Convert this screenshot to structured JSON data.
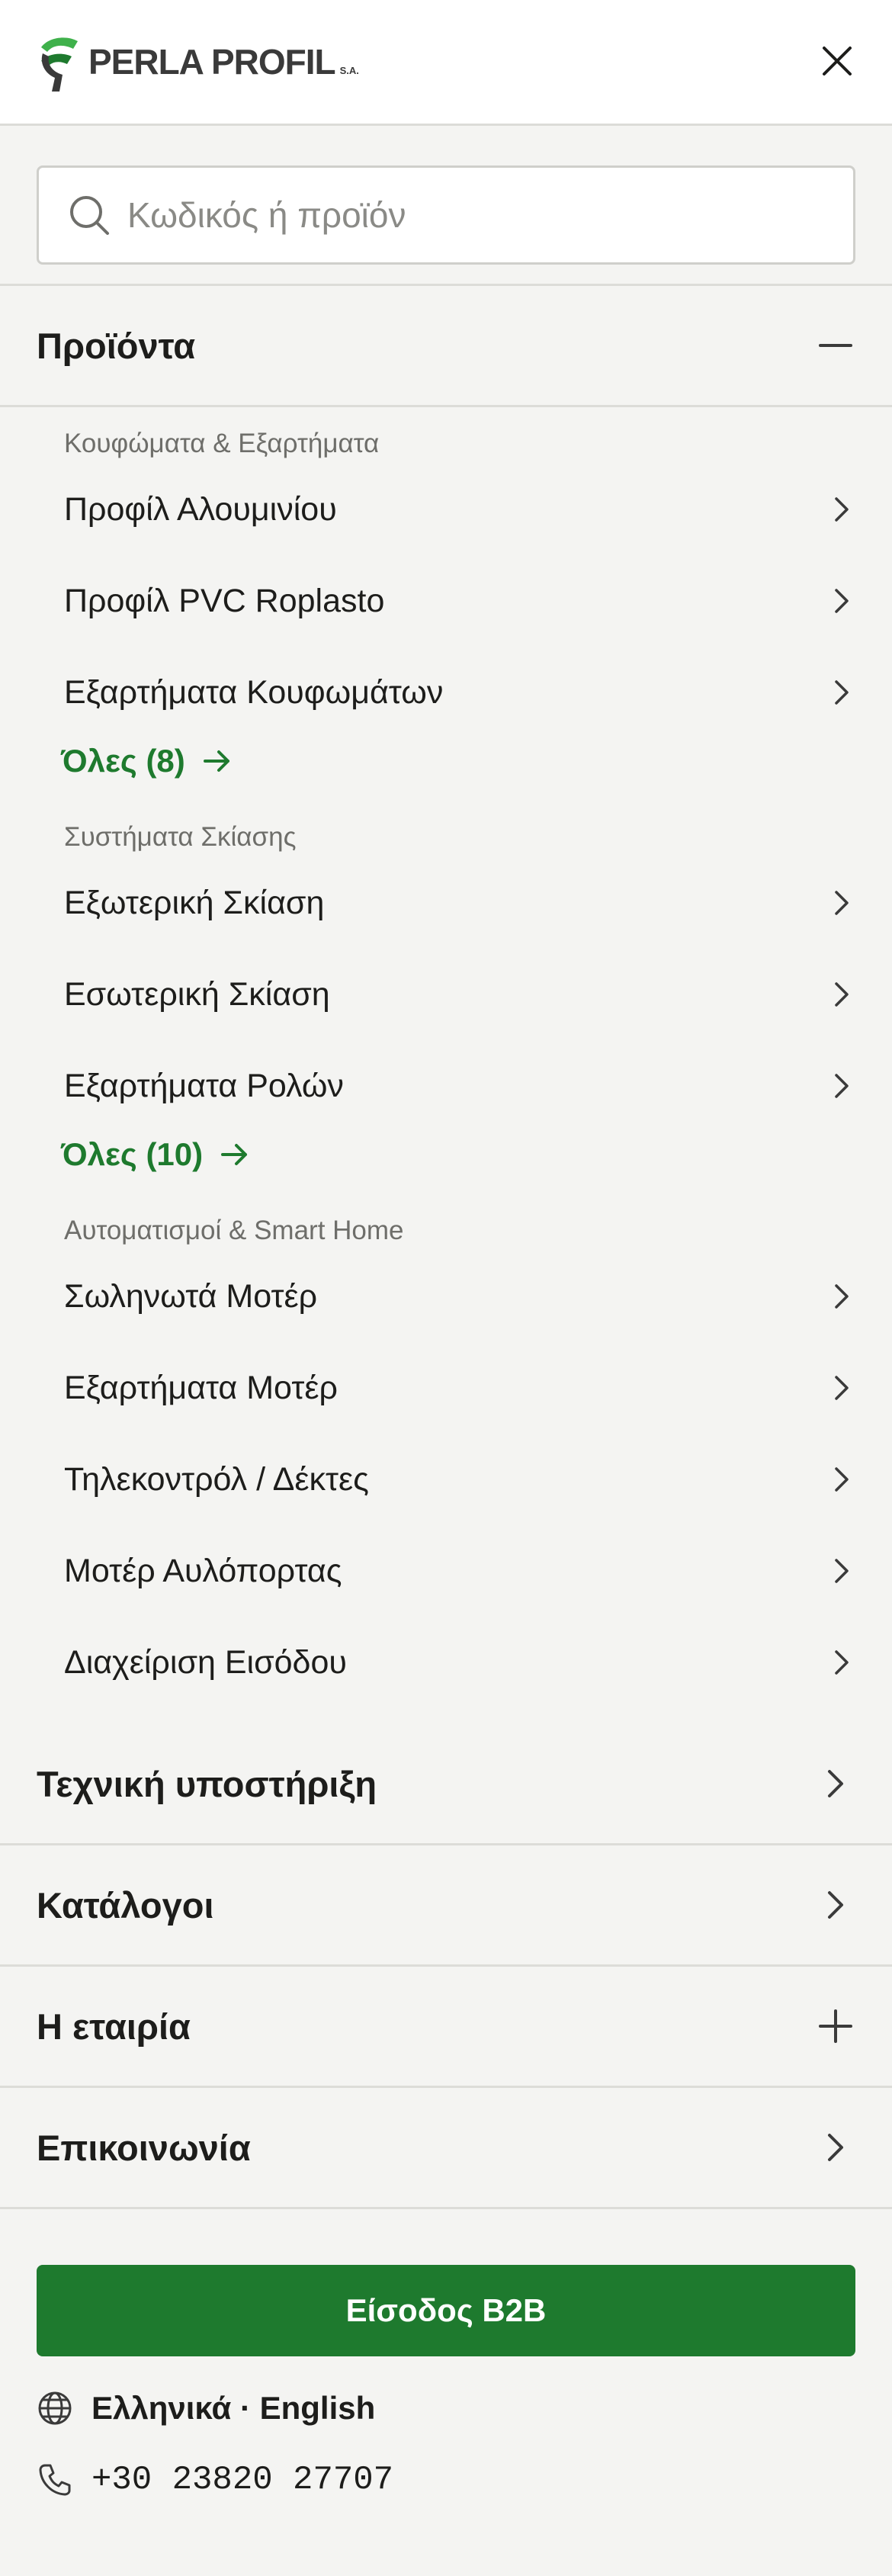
{
  "brand": {
    "name": "PERLA PROFIL",
    "suffix": "S.A.",
    "accent": "#1e7a2e",
    "logo_colors": [
      "#3fb14b",
      "#1e7a2e",
      "#3a3a3a"
    ]
  },
  "header": {
    "close_icon": "close-icon"
  },
  "search": {
    "placeholder": "Κωδικός ή προϊόν",
    "value": "",
    "icon": "search-icon"
  },
  "menu": {
    "products": {
      "label": "Προϊόντα",
      "expanded": true,
      "toggle_icon": "minus-icon",
      "groups": [
        {
          "title": "Κουφώματα & Εξαρτήματα",
          "items": [
            "Προφίλ Αλουμινίου",
            "Προφίλ PVC Roplasto",
            "Εξαρτήματα Κουφωμάτων"
          ],
          "all_label": "Όλες (8)"
        },
        {
          "title": "Συστήματα Σκίασης",
          "items": [
            "Εξωτερική Σκίαση",
            "Εσωτερική Σκίαση",
            "Εξαρτήματα Ρολών"
          ],
          "all_label": "Όλες (10)"
        },
        {
          "title": "Αυτοματισμοί & Smart Home",
          "items": [
            "Σωληνωτά Μοτέρ",
            "Εξαρτήματα Μοτέρ",
            "Τηλεκοντρόλ / Δέκτες",
            "Μοτέρ Αυλόπορτας",
            "Διαχείριση Εισόδου"
          ]
        }
      ]
    },
    "support": {
      "label": "Τεχνική υποστήριξη",
      "icon": "chevron-right-icon"
    },
    "catalogs": {
      "label": "Κατάλογοι",
      "icon": "chevron-right-icon"
    },
    "company": {
      "label": "Η εταιρία",
      "icon": "plus-icon"
    },
    "contact": {
      "label": "Επικοινωνία",
      "icon": "chevron-right-icon"
    }
  },
  "footer": {
    "b2b_button": "Είσοδος B2B",
    "languages": {
      "current": "Ελληνικά",
      "separator": "·",
      "other": "English"
    },
    "phone": "+30 23820 27707"
  }
}
